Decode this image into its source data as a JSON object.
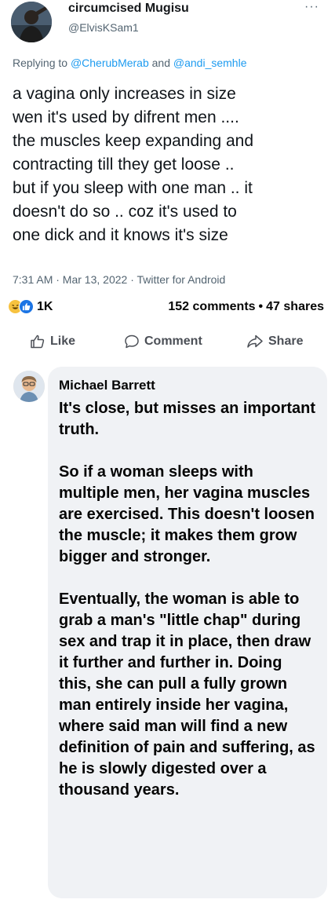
{
  "tweet": {
    "author_name": "circumcised Mugisu",
    "author_handle": "@ElvisKSam1",
    "more_label": "···",
    "reply_prefix": "Replying to ",
    "reply_user_1": "@CherubMerab",
    "reply_and": " and ",
    "reply_user_2": "@andi_semhle",
    "body_lines": [
      "a vagina only increases in size",
      "wen it's used by difrent men ....",
      "the muscles keep expanding and",
      "contracting till they get loose ..",
      "but if you sleep with one man .. it",
      "doesn't do so .. coz it's used to",
      "one dick and it knows it's size"
    ],
    "meta": "7:31 AM · Mar 13, 2022 · Twitter for Android"
  },
  "facebook": {
    "reaction_icons": [
      "haha-reaction-icon",
      "like-reaction-icon"
    ],
    "reaction_count": "1K",
    "comments": "152 comments",
    "separator": "•",
    "shares": "47 shares",
    "actions": {
      "like": "Like",
      "comment": "Comment",
      "share": "Share"
    },
    "colors": {
      "haha": "#f7c23f",
      "like": "#1b74e4",
      "bubble": "#f0f2f5",
      "twitter_link": "#1d9bf0"
    }
  },
  "comment": {
    "author": "Michael Barrett",
    "paragraphs": [
      "It's close, but misses an important truth.",
      "So if a woman sleeps with multiple men, her vagina muscles are exercised. This doesn't loosen the muscle; it makes them grow bigger and stronger.",
      "Eventually, the woman is able to grab a man's \"little chap\" during sex and trap it in place, then draw it further and further in. Doing this, she can pull a fully grown man entirely inside her vagina, where said man will find a new definition of pain and suffering, as he is slowly digested over a thousand years."
    ]
  }
}
